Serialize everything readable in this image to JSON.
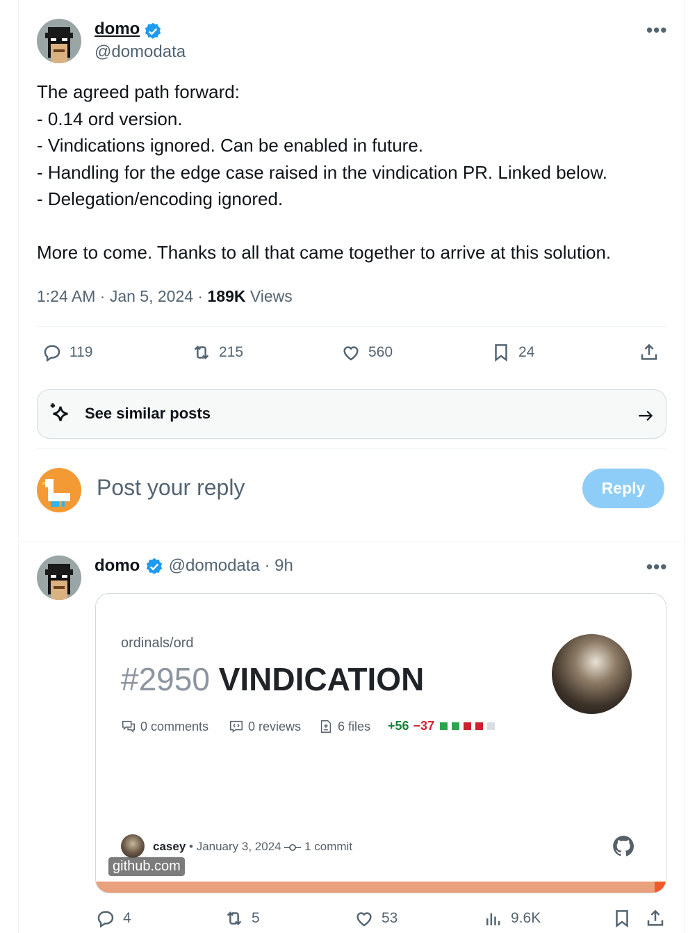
{
  "tweet": {
    "author": {
      "name": "domo",
      "handle": "@domodata",
      "verified": true
    },
    "more_icon": "more-dots-icon",
    "body": "The agreed path forward:\n- 0.14 ord version.\n- Vindications ignored. Can be enabled in future.\n- Handling for the edge case raised in the vindication PR. Linked below.\n- Delegation/encoding ignored.\n\nMore to come. Thanks to all that came together to arrive at this solution.",
    "time": "1:24 AM · Jan 5, 2024 · ",
    "views_count": "189K",
    "views_label": " Views",
    "actions": {
      "replies": "119",
      "reposts": "215",
      "likes": "560",
      "bookmarks": "24"
    }
  },
  "similar": {
    "label": "See similar posts"
  },
  "reply_box": {
    "placeholder": "Post your reply",
    "button": "Reply"
  },
  "reply": {
    "author": {
      "name": "domo",
      "handle": "@domodata",
      "time": "· 9h"
    },
    "card": {
      "repo": "ordinals/ord",
      "pr_number": "#2950",
      "pr_title": "VINDICATION",
      "comments": "0 comments",
      "reviews": "0 reviews",
      "files": "6 files",
      "additions": "+56",
      "deletions": "−37",
      "author": "casey",
      "date": "• January 3, 2024",
      "commits": "1 commit",
      "domain": "github.com"
    },
    "actions": {
      "replies": "4",
      "reposts": "5",
      "likes": "53",
      "views": "9.6K"
    }
  },
  "colors": {
    "verified": "#1d9bf0",
    "reply_button": "#8ecdf8",
    "additions": "#1a7f37",
    "deletions": "#cf222e",
    "card_bar": "#e8a17c"
  }
}
